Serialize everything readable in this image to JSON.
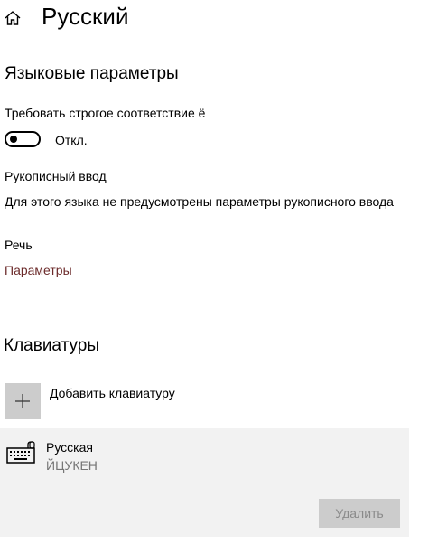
{
  "header": {
    "title": "Русский",
    "home_icon": "home-icon"
  },
  "language_options": {
    "heading": "Языковые параметры",
    "strict_yo": {
      "label": "Требовать строгое соответствие ё",
      "toggle_state": "Откл.",
      "on": false
    },
    "handwriting": {
      "heading": "Рукописный ввод",
      "text": "Для этого языка не предусмотрены параметры рукописного ввода"
    },
    "speech": {
      "heading": "Речь",
      "link": "Параметры"
    }
  },
  "keyboards": {
    "heading": "Клавиатуры",
    "add_label": "Добавить клавиатуру",
    "items": [
      {
        "name": "Русская",
        "layout": "ЙЦУКЕН",
        "remove_label": "Удалить",
        "remove_enabled": false
      }
    ]
  },
  "colors": {
    "link": "#6b2a2a",
    "tile": "#cccccc",
    "panel": "#f2f2f2",
    "disabled_text": "#8a8a8a"
  }
}
